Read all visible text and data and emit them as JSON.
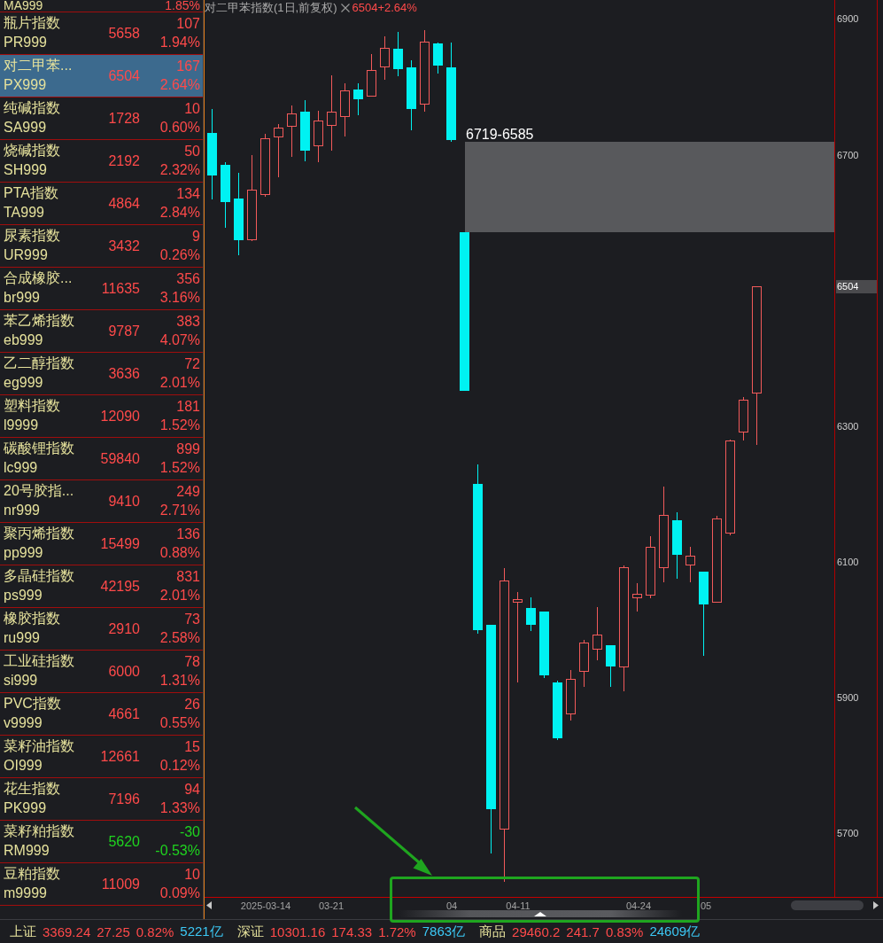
{
  "watchlist": {
    "cut_row": {
      "code": "MA999",
      "percent": "1.85%"
    },
    "rows": [
      {
        "name": "瓶片指数",
        "code": "PR999",
        "price": "5658",
        "change": "107",
        "percent": "1.94%",
        "color": "#ff4a4a",
        "selected": false
      },
      {
        "name": "对二甲苯...",
        "code": "PX999",
        "price": "6504",
        "change": "167",
        "percent": "2.64%",
        "color": "#ff4a4a",
        "selected": true
      },
      {
        "name": "纯碱指数",
        "code": "SA999",
        "price": "1728",
        "change": "10",
        "percent": "0.60%",
        "color": "#ff4a4a",
        "selected": false
      },
      {
        "name": "烧碱指数",
        "code": "SH999",
        "price": "2192",
        "change": "50",
        "percent": "2.32%",
        "color": "#ff4a4a",
        "selected": false
      },
      {
        "name": "PTA指数",
        "code": "TA999",
        "price": "4864",
        "change": "134",
        "percent": "2.84%",
        "color": "#ff4a4a",
        "selected": false
      },
      {
        "name": "尿素指数",
        "code": "UR999",
        "price": "3432",
        "change": "9",
        "percent": "0.26%",
        "color": "#ff4a4a",
        "selected": false
      },
      {
        "name": "合成橡胶...",
        "code": "br999",
        "price": "11635",
        "change": "356",
        "percent": "3.16%",
        "color": "#ff4a4a",
        "selected": false
      },
      {
        "name": "苯乙烯指数",
        "code": "eb999",
        "price": "9787",
        "change": "383",
        "percent": "4.07%",
        "color": "#ff4a4a",
        "selected": false
      },
      {
        "name": "乙二醇指数",
        "code": "eg999",
        "price": "3636",
        "change": "72",
        "percent": "2.01%",
        "color": "#ff4a4a",
        "selected": false
      },
      {
        "name": "塑料指数",
        "code": "l9999",
        "price": "12090",
        "change": "181",
        "percent": "1.52%",
        "color": "#ff4a4a",
        "selected": false
      },
      {
        "name": "碳酸锂指数",
        "code": "lc999",
        "price": "59840",
        "change": "899",
        "percent": "1.52%",
        "color": "#ff4a4a",
        "selected": false
      },
      {
        "name": "20号胶指...",
        "code": "nr999",
        "price": "9410",
        "change": "249",
        "percent": "2.71%",
        "color": "#ff4a4a",
        "selected": false
      },
      {
        "name": "聚丙烯指数",
        "code": "pp999",
        "price": "15499",
        "change": "136",
        "percent": "0.88%",
        "color": "#ff4a4a",
        "selected": false
      },
      {
        "name": "多晶硅指数",
        "code": "ps999",
        "price": "42195",
        "change": "831",
        "percent": "2.01%",
        "color": "#ff4a4a",
        "selected": false
      },
      {
        "name": "橡胶指数",
        "code": "ru999",
        "price": "2910",
        "change": "73",
        "percent": "2.58%",
        "color": "#ff4a4a",
        "selected": false
      },
      {
        "name": "工业硅指数",
        "code": "si999",
        "price": "6000",
        "change": "78",
        "percent": "1.31%",
        "color": "#ff4a4a",
        "selected": false
      },
      {
        "name": "PVC指数",
        "code": "v9999",
        "price": "4661",
        "change": "26",
        "percent": "0.55%",
        "color": "#ff4a4a",
        "selected": false
      },
      {
        "name": "菜籽油指数",
        "code": "OI999",
        "price": "12661",
        "change": "15",
        "percent": "0.12%",
        "color": "#ff4a4a",
        "selected": false
      },
      {
        "name": "花生指数",
        "code": "PK999",
        "price": "7196",
        "change": "94",
        "percent": "1.33%",
        "color": "#ff4a4a",
        "selected": false
      },
      {
        "name": "菜籽粕指数",
        "code": "RM999",
        "price": "5620",
        "change": "-30",
        "percent": "-0.53%",
        "color": "#1fd41f",
        "selected": false
      },
      {
        "name": "豆粕指数",
        "code": "m9999",
        "price": "11009",
        "change": "10",
        "percent": "0.09%",
        "color": "#ff4a4a",
        "selected": false
      }
    ]
  },
  "chart": {
    "title": "对二甲苯指数(1日,前复权)",
    "quote": "6504+2.64%",
    "gap_label": "6719-6585",
    "price_axis": {
      "ticks": [
        "6900",
        "6700",
        "6300",
        "6100",
        "5900",
        "5700"
      ],
      "current": "6504"
    },
    "time_axis": {
      "labels": [
        "2025-03-14",
        "03-21",
        "04",
        "04-11",
        "04-24",
        "05"
      ]
    }
  },
  "status_bar": {
    "indices": [
      {
        "name": "上证",
        "value": "3369.24",
        "change": "27.25",
        "percent": "0.82%",
        "turnover": "5221亿"
      },
      {
        "name": "深证",
        "value": "10301.16",
        "change": "174.33",
        "percent": "1.72%",
        "turnover": "7863亿"
      },
      {
        "name": "商品",
        "value": "29460.2",
        "change": "241.7",
        "percent": "0.83%",
        "turnover": "24609亿"
      }
    ]
  }
}
